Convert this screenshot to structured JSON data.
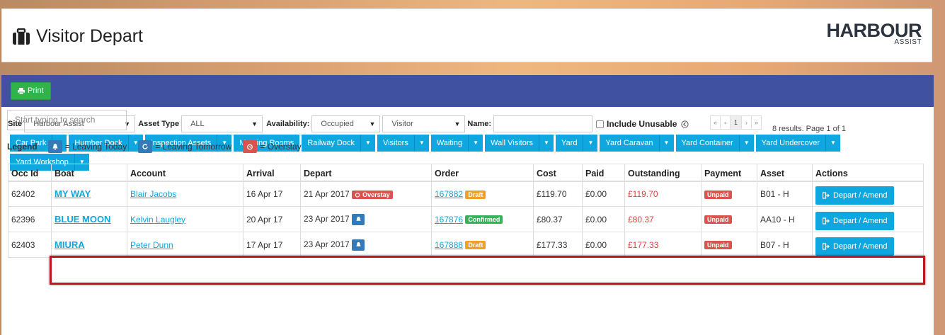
{
  "page": {
    "title": "Visitor Depart"
  },
  "logo": {
    "main": "HARBOUR",
    "sub": "ASSIST"
  },
  "toolbar": {
    "print_label": "Print"
  },
  "filters": {
    "site_label": "Site",
    "site_value": "Harbour Assist",
    "asset_type_label": "Asset Type",
    "asset_type_value": "ALL",
    "availability_label": "Availability:",
    "availability_value": "Occupied",
    "visitor_value": "Visitor",
    "name_label": "Name:",
    "name_value": "",
    "include_unusable_label": "Include Unusable"
  },
  "pager": {
    "first": "«",
    "prev": "‹",
    "page": "1",
    "next": "›",
    "last": "»",
    "results": "8 results. Page 1 of 1"
  },
  "categories": [
    "Car Park",
    "Humber Dock",
    "Inspection Assets",
    "Meeting Rooms",
    "Railway Dock",
    "Visitors",
    "Waiting",
    "Wall Visitors",
    "Yard",
    "Yard Caravan",
    "Yard Container",
    "Yard Undercover",
    "Yard Workshop"
  ],
  "search": {
    "placeholder": "Start typing to search"
  },
  "legend": {
    "title": "Legend",
    "leaving_today": "= Leaving Today",
    "leaving_tomorrow": "= Leaving Tomorrow",
    "overstay": "= Overstay"
  },
  "table": {
    "headers": [
      "Occ Id",
      "Boat",
      "Account",
      "Arrival",
      "Depart",
      "Order",
      "Cost",
      "Paid",
      "Outstanding",
      "Payment",
      "Asset",
      "Actions"
    ],
    "rows": [
      {
        "occ_id": "62402",
        "boat": "MY WAY",
        "account": "Blair Jacobs",
        "arrival": "16 Apr 17",
        "depart": "21 Apr 2017",
        "depart_badge": "Overstay",
        "order": "167882",
        "order_status": "Draft",
        "cost": "£119.70",
        "paid": "£0.00",
        "outstanding": "£119.70",
        "payment": "Unpaid",
        "asset": "B01 - H",
        "action": "Depart / Amend"
      },
      {
        "occ_id": "62396",
        "boat": "BLUE MOON",
        "account": "Kelvin Laugley",
        "arrival": "20 Apr 17",
        "depart": "23 Apr 2017",
        "order": "167876",
        "order_status": "Confirmed",
        "cost": "£80.37",
        "paid": "£0.00",
        "outstanding": "£80.37",
        "payment": "Unpaid",
        "asset": "AA10 - H",
        "action": "Depart / Amend"
      },
      {
        "occ_id": "62403",
        "boat": "MIURA",
        "account": "Peter Dunn",
        "arrival": "17 Apr 17",
        "depart": "23 Apr 2017",
        "order": "167888",
        "order_status": "Draft",
        "cost": "£177.33",
        "paid": "£0.00",
        "outstanding": "£177.33",
        "payment": "Unpaid",
        "asset": "B07 - H",
        "action": "Depart / Amend"
      }
    ]
  }
}
